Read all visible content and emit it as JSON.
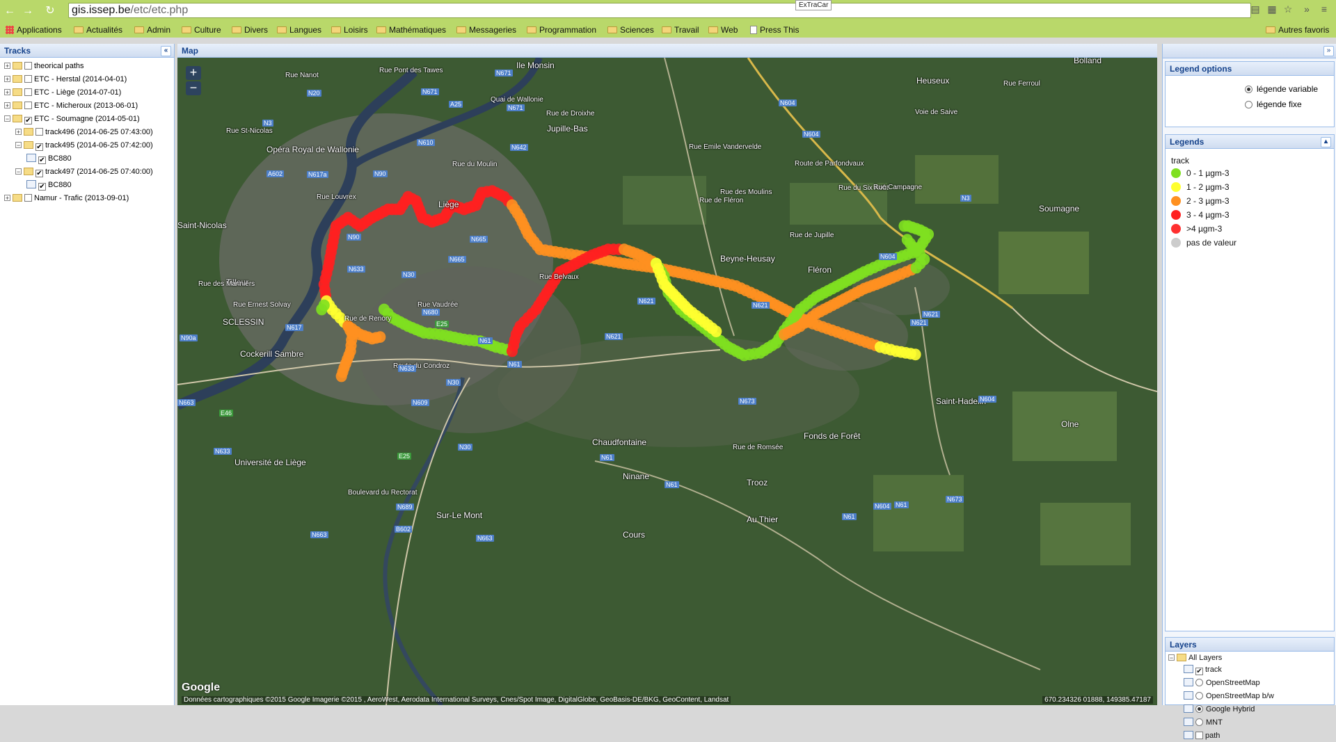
{
  "browser": {
    "url_host": "gis.issep.be",
    "url_path": "/etc/etc.php",
    "extension_tooltip": "ExTraCar",
    "bookmarks": [
      "Applications",
      "Actualités",
      "Admin",
      "Culture",
      "Divers",
      "Langues",
      "Loisirs",
      "Mathématiques",
      "Messageries",
      "Programmation",
      "Sciences",
      "Travail",
      "Web",
      "Press This"
    ],
    "other_bookmarks": "Autres favoris"
  },
  "tracks_panel": {
    "title": "Tracks",
    "tree": [
      {
        "label": "theorical paths",
        "level": 0,
        "expand": "+",
        "checked": false,
        "type": "folder"
      },
      {
        "label": "ETC - Herstal (2014-04-01)",
        "level": 0,
        "expand": "+",
        "checked": false,
        "type": "folder"
      },
      {
        "label": "ETC - Liège (2014-07-01)",
        "level": 0,
        "expand": "+",
        "checked": false,
        "type": "folder"
      },
      {
        "label": "ETC - Micheroux (2013-06-01)",
        "level": 0,
        "expand": "+",
        "checked": false,
        "type": "folder"
      },
      {
        "label": "ETC - Soumagne (2014-05-01)",
        "level": 0,
        "expand": "−",
        "checked": true,
        "type": "folder"
      },
      {
        "label": "track496 (2014-06-25 07:43:00)",
        "level": 1,
        "expand": "+",
        "checked": false,
        "type": "folder"
      },
      {
        "label": "track495 (2014-06-25 07:42:00)",
        "level": 1,
        "expand": "−",
        "checked": true,
        "type": "folder"
      },
      {
        "label": "BC880",
        "level": 2,
        "expand": "",
        "checked": true,
        "type": "leaf"
      },
      {
        "label": "track497 (2014-06-25 07:40:00)",
        "level": 1,
        "expand": "−",
        "checked": true,
        "type": "folder"
      },
      {
        "label": "BC880",
        "level": 2,
        "expand": "",
        "checked": true,
        "type": "leaf"
      },
      {
        "label": "Namur - Trafic (2013-09-01)",
        "level": 0,
        "expand": "+",
        "checked": false,
        "type": "folder"
      }
    ]
  },
  "map_panel": {
    "title": "Map",
    "zoom_in": "+",
    "zoom_out": "−",
    "attribution": "Données cartographiques ©2015 Google Imagerie ©2015 , AeroWest, Aerodata International Surveys, Cnes/Spot Image, DigitalGlobe, GeoBasis-DE/BKG, GeoContent, Landsat",
    "google_logo": "Google",
    "coordinates": "670.234326 01888, 149385.47187",
    "places": [
      "Ile Monsin",
      "Heuseux",
      "Bolland",
      "Soumagne",
      "Saint-Nicolas",
      "Tilleur",
      "Fléron",
      "Beyne-Heusay",
      "Cockerill Sambre",
      "Chaudfontaine",
      "Ninane",
      "Fonds de Forêt",
      "Saint-Hadelin",
      "Olne",
      "Trooz",
      "Au Thier",
      "Sur-Le Mont",
      "Cours",
      "Université de Liège",
      "Opéra Royal de Wallonie",
      "Jupille-Bas",
      "Liège",
      "SCLESSIN"
    ],
    "streets": [
      "Rue Pont des Tawes",
      "Quai de Wallonie",
      "Rue de Droixhe",
      "Rue du Moulin",
      "Rue Louvrex",
      "Rue Ernest Solvay",
      "Rue de Renory",
      "Rue Vaudrée",
      "Route du Condroz",
      "Boulevard du Rectorat",
      "Rue Emile Vandervelde",
      "Rue des Moulins",
      "Rue de Jupille",
      "Rue du Six Août",
      "Rue Campagne",
      "Voie de Saive",
      "Rue Ferroul",
      "Rue de Fléron",
      "Route de Parfondvaux",
      "Rue de Romsée",
      "Rue Belvaux",
      "Rue des Mariniers",
      "Rue St-Nicolas",
      "Rue Nanot"
    ],
    "routes": [
      "N671",
      "N20",
      "N3",
      "N671",
      "A25",
      "N671",
      "N610",
      "N642",
      "N90",
      "N617a",
      "A602",
      "N90",
      "N633",
      "N30",
      "N665",
      "N665",
      "N617",
      "N680",
      "E25",
      "N90a",
      "N61",
      "N633",
      "N61",
      "N30",
      "N609",
      "N30",
      "E25",
      "N663",
      "N633",
      "N689",
      "N663",
      "N663",
      "E46",
      "N621",
      "N621",
      "N621",
      "N604",
      "N604",
      "N3",
      "N604",
      "N621",
      "N673",
      "N61",
      "N61",
      "N621",
      "N604",
      "N604",
      "N61",
      "N673",
      "N61",
      "B602"
    ]
  },
  "legend_options": {
    "title": "Legend options",
    "options": [
      {
        "label": "légende variable",
        "selected": true
      },
      {
        "label": "légende fixe",
        "selected": false
      }
    ]
  },
  "legends": {
    "title": "Legends",
    "layer_name": "track",
    "items": [
      {
        "label": "0 - 1 µgm-3",
        "color": "#7fe020"
      },
      {
        "label": "1 - 2 µgm-3",
        "color": "#ffff30"
      },
      {
        "label": "2 - 3 µgm-3",
        "color": "#ff9020"
      },
      {
        "label": "3 - 4 µgm-3",
        "color": "#ff2020"
      },
      {
        "label": ">4 µgm-3",
        "color": "#ff3030"
      },
      {
        "label": "pas de valeur",
        "color": "#cccccc"
      }
    ]
  },
  "layers": {
    "title": "Layers",
    "root": "All Layers",
    "items": [
      {
        "label": "track",
        "control": "checkbox",
        "on": true
      },
      {
        "label": "OpenStreetMap",
        "control": "radio",
        "on": false
      },
      {
        "label": "OpenStreetMap b/w",
        "control": "radio",
        "on": false
      },
      {
        "label": "Google Hybrid",
        "control": "radio",
        "on": true
      },
      {
        "label": "MNT",
        "control": "radio",
        "on": false
      },
      {
        "label": "path",
        "control": "checkbox",
        "on": false
      }
    ]
  },
  "colors": {
    "green": "#7fe020",
    "yellow": "#ffff30",
    "orange": "#ff9020",
    "red": "#ff2020"
  }
}
